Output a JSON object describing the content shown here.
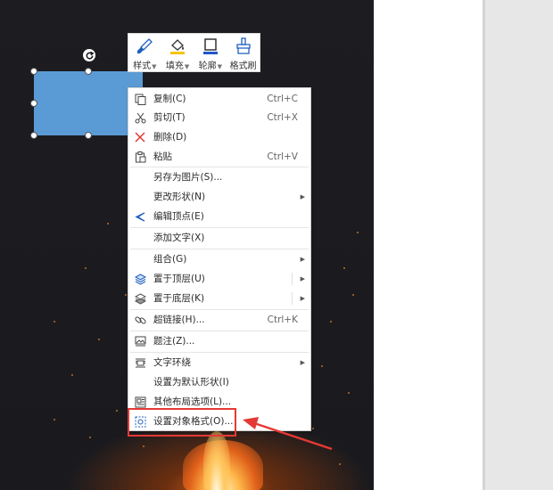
{
  "toolbar": {
    "style_label": "样式",
    "fill_label": "填充",
    "outline_label": "轮廓",
    "format_painter_label": "格式刷"
  },
  "menu": {
    "items": [
      {
        "label": "复制(C)",
        "shortcut": "Ctrl+C",
        "icon": "copy-icon"
      },
      {
        "label": "剪切(T)",
        "shortcut": "Ctrl+X",
        "icon": "cut-icon"
      },
      {
        "label": "删除(D)",
        "shortcut": "",
        "icon": "delete-icon"
      },
      {
        "label": "粘贴",
        "shortcut": "Ctrl+V",
        "icon": "paste-icon"
      },
      {
        "label": "另存为图片(S)...",
        "shortcut": "",
        "icon": ""
      },
      {
        "label": "更改形状(N)",
        "shortcut": "",
        "icon": ""
      },
      {
        "label": "编辑顶点(E)",
        "shortcut": "",
        "icon": "edit-points-icon"
      },
      {
        "label": "添加文字(X)",
        "shortcut": "",
        "icon": ""
      },
      {
        "label": "组合(G)",
        "shortcut": "",
        "icon": ""
      },
      {
        "label": "置于顶层(U)",
        "shortcut": "",
        "icon": "bring-to-front-icon"
      },
      {
        "label": "置于底层(K)",
        "shortcut": "",
        "icon": "send-to-back-icon"
      },
      {
        "label": "超链接(H)...",
        "shortcut": "Ctrl+K",
        "icon": "hyperlink-icon"
      },
      {
        "label": "题注(Z)...",
        "shortcut": "",
        "icon": "caption-icon"
      },
      {
        "label": "文字环绕",
        "shortcut": "",
        "icon": "text-wrap-icon"
      },
      {
        "label": "设置为默认形状(I)",
        "shortcut": "",
        "icon": ""
      },
      {
        "label": "其他布局选项(L)...",
        "shortcut": "",
        "icon": "layout-options-icon"
      },
      {
        "label": "设置对象格式(O)...",
        "shortcut": "",
        "icon": "format-object-icon"
      }
    ]
  },
  "colors": {
    "shape_fill": "#5b9bd5",
    "highlight": "#e53935",
    "canvas_bg": "#1d1d21",
    "fill_underline": "#f5c400",
    "outline_underline": "#2155c9"
  }
}
